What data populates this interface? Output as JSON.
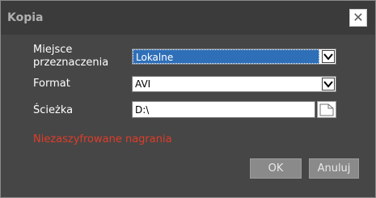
{
  "dialog": {
    "title": "Kopia",
    "close_glyph": "✕"
  },
  "form": {
    "destination_label": "Miejsce przeznaczenia",
    "destination_value": "Lokalne",
    "format_label": "Format",
    "format_value": "AVI",
    "path_label": "Ścieżka",
    "path_value": "D:\\"
  },
  "warning": "Niezaszyfrowane nagrania",
  "buttons": {
    "ok": "OK",
    "cancel": "Anuluj"
  },
  "icons": {
    "close": "close-icon",
    "dropdown": "chevron-down-icon",
    "browse": "folder-icon"
  },
  "colors": {
    "background": "#464646",
    "titlebar": "#3b3b3b",
    "selection": "#2f6fb8",
    "warning": "#e03c28",
    "button": "#8a8a8a"
  }
}
